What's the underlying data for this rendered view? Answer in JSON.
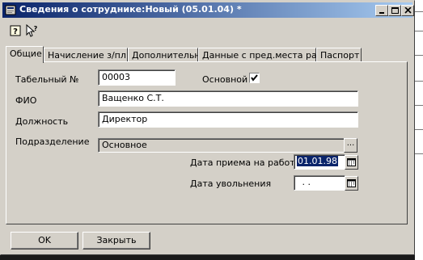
{
  "window": {
    "title": "Сведения о сотруднике:Новый (05.01.04) *"
  },
  "titlebar_buttons": {
    "minimize_icon": "minimize-icon",
    "maximize_icon": "maximize-icon",
    "close_icon": "close-icon"
  },
  "toolbar": {
    "help_icon": "help-icon",
    "context_help_icon": "pointer-question-icon"
  },
  "tabs": [
    {
      "label": "Общие",
      "active": true
    },
    {
      "label": "Начисление з/пл",
      "active": false
    },
    {
      "label": "Дополнительно",
      "active": false
    },
    {
      "label": "Данные с пред.места раб.",
      "active": false
    },
    {
      "label": "Паспорт",
      "active": false
    }
  ],
  "form": {
    "tabel_label": "Табельный №",
    "tabel_value": "00003",
    "main_label": "Основной",
    "main_checked": true,
    "fio_label": "ФИО",
    "fio_value": "Ващенко С.Т.",
    "position_label": "Должность",
    "position_value": "Директор",
    "division_label": "Подразделение",
    "division_value": "Основное",
    "division_button": "...",
    "hire_date_label": "Дата приема на работу",
    "hire_date_value": "01.01.98",
    "dismiss_date_label": "Дата увольнения",
    "dismiss_date_value": " . ."
  },
  "buttons": {
    "ok_label": "OK",
    "close_label": "Закрыть"
  },
  "colors": {
    "title_gradient_start": "#0a246a",
    "title_gradient_end": "#a6caf0",
    "face": "#d4d0c8",
    "selection": "#0a246a"
  }
}
